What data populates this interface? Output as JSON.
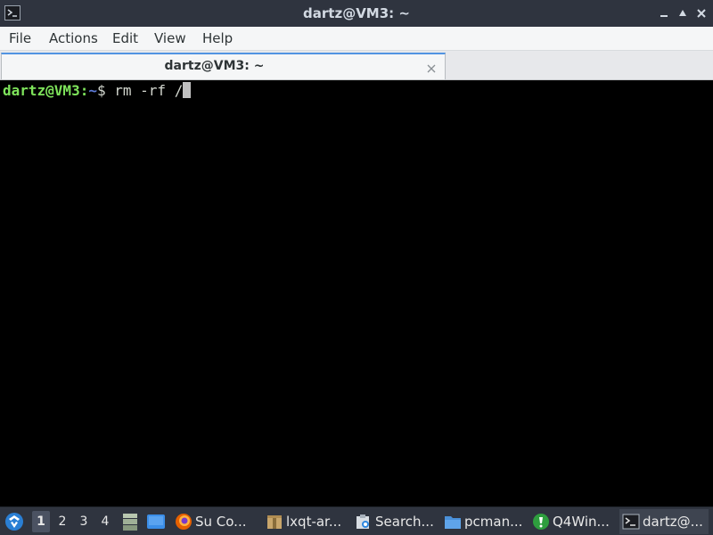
{
  "window": {
    "title": "dartz@VM3: ~"
  },
  "menu": {
    "items": [
      "File",
      "Actions",
      "Edit",
      "View",
      "Help"
    ]
  },
  "tab": {
    "label": "dartz@VM3: ~"
  },
  "terminal": {
    "user_host": "dartz@VM3",
    "colon": ":",
    "path": "~",
    "dollar": "$",
    "command": " rm -rf /"
  },
  "taskbar": {
    "desktops": [
      "1",
      "2",
      "3",
      "4"
    ],
    "active_desktop": "1",
    "tasks": [
      {
        "label": "Su Co...",
        "icon": "firefox-icon"
      },
      {
        "label": "lxqt-ar...",
        "icon": "archive-icon"
      },
      {
        "label": "Search...",
        "icon": "search-tool-icon"
      },
      {
        "label": "pcman...",
        "icon": "folder-icon"
      },
      {
        "label": "Q4Win...",
        "icon": "q4wine-icon"
      },
      {
        "label": "dartz@...",
        "icon": "terminal-icon"
      }
    ]
  },
  "colors": {
    "titlebar": "#2f343f",
    "prompt_user": "#7ee35b",
    "prompt_path": "#5d7ad7",
    "accent": "#5294e2"
  }
}
